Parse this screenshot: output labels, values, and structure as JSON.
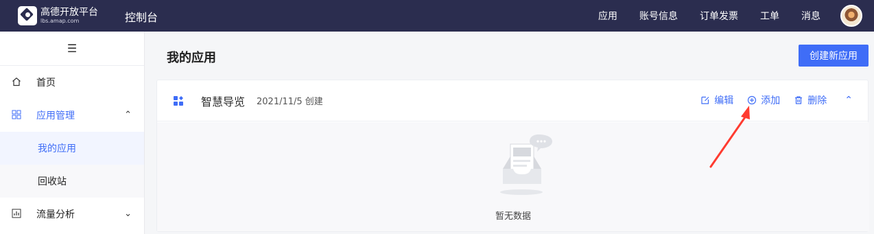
{
  "brand": {
    "name": "高德开放平台",
    "domain": "lbs.amap.com"
  },
  "topbar": {
    "console_title": "控制台",
    "nav": [
      "应用",
      "账号信息",
      "订单发票",
      "工单",
      "消息"
    ]
  },
  "sidebar": {
    "items": [
      {
        "label": "首页",
        "icon": "home-icon"
      },
      {
        "label": "应用管理",
        "icon": "grid-icon",
        "expanded": true
      },
      {
        "label": "我的应用",
        "selected": true
      },
      {
        "label": "回收站"
      },
      {
        "label": "流量分析",
        "icon": "chart-icon",
        "expanded": false
      }
    ]
  },
  "main": {
    "page_title": "我的应用",
    "create_button": "创建新应用",
    "app": {
      "name": "智慧导览",
      "created": "2021/11/5 创建",
      "actions": [
        "编辑",
        "添加",
        "删除"
      ],
      "empty_text": "暂无数据"
    }
  },
  "colors": {
    "topbar": "#2b2d4f",
    "accent": "#3f6df7",
    "annotation": "#ff3b30"
  }
}
